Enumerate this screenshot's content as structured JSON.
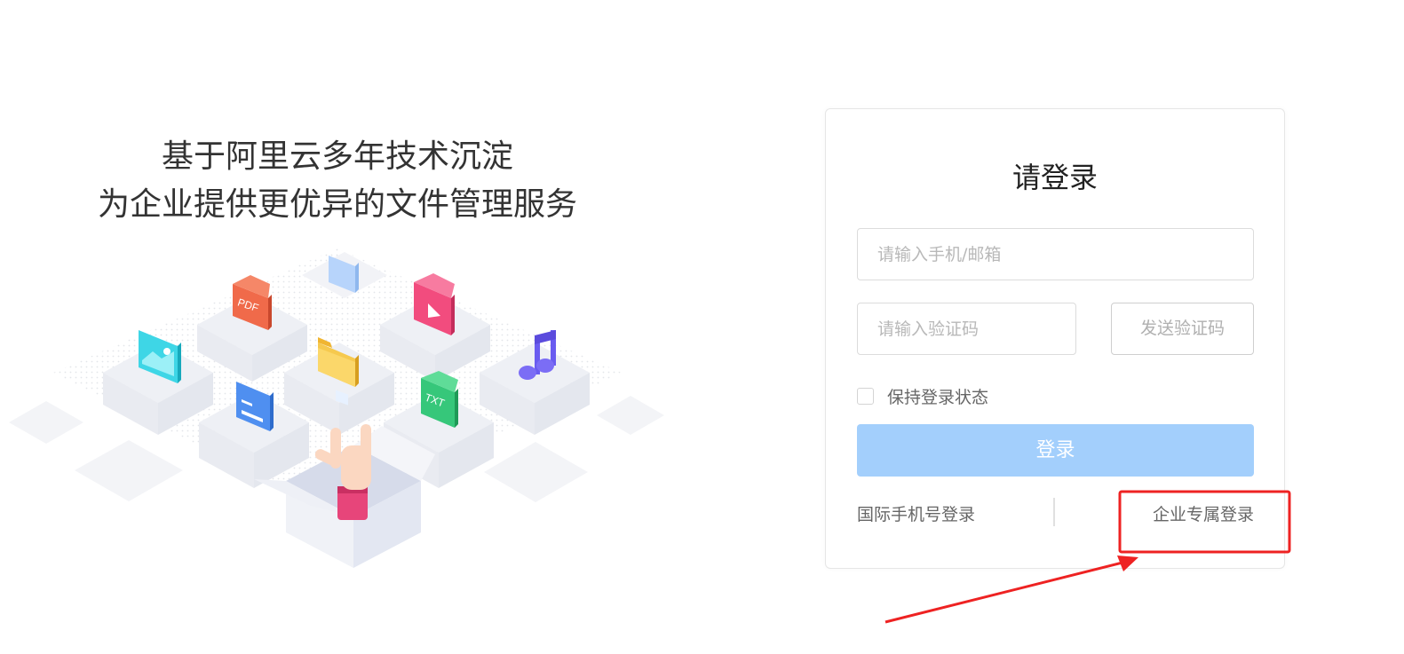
{
  "slogan": {
    "line1": "基于阿里云多年技术沉淀",
    "line2": "为企业提供更优异的文件管理服务"
  },
  "illustration": {
    "icons": [
      "pdf-file-icon",
      "image-file-icon",
      "video-file-icon",
      "folder-icon",
      "doc-file-icon",
      "txt-file-icon",
      "music-note-icon",
      "rock-hand-icon",
      "open-box-icon"
    ],
    "pdf_label": "PDF",
    "txt_label": "TXT"
  },
  "login": {
    "title": "请登录",
    "phone_placeholder": "请输入手机/邮箱",
    "code_placeholder": "请输入验证码",
    "send_code_label": "发送验证码",
    "remember_label": "保持登录状态",
    "submit_label": "登录",
    "intl_phone_link": "国际手机号登录",
    "enterprise_link": "企业专属登录"
  },
  "colors": {
    "primary_disabled": "#a3cffc",
    "annotation_red": "#ee2222"
  }
}
